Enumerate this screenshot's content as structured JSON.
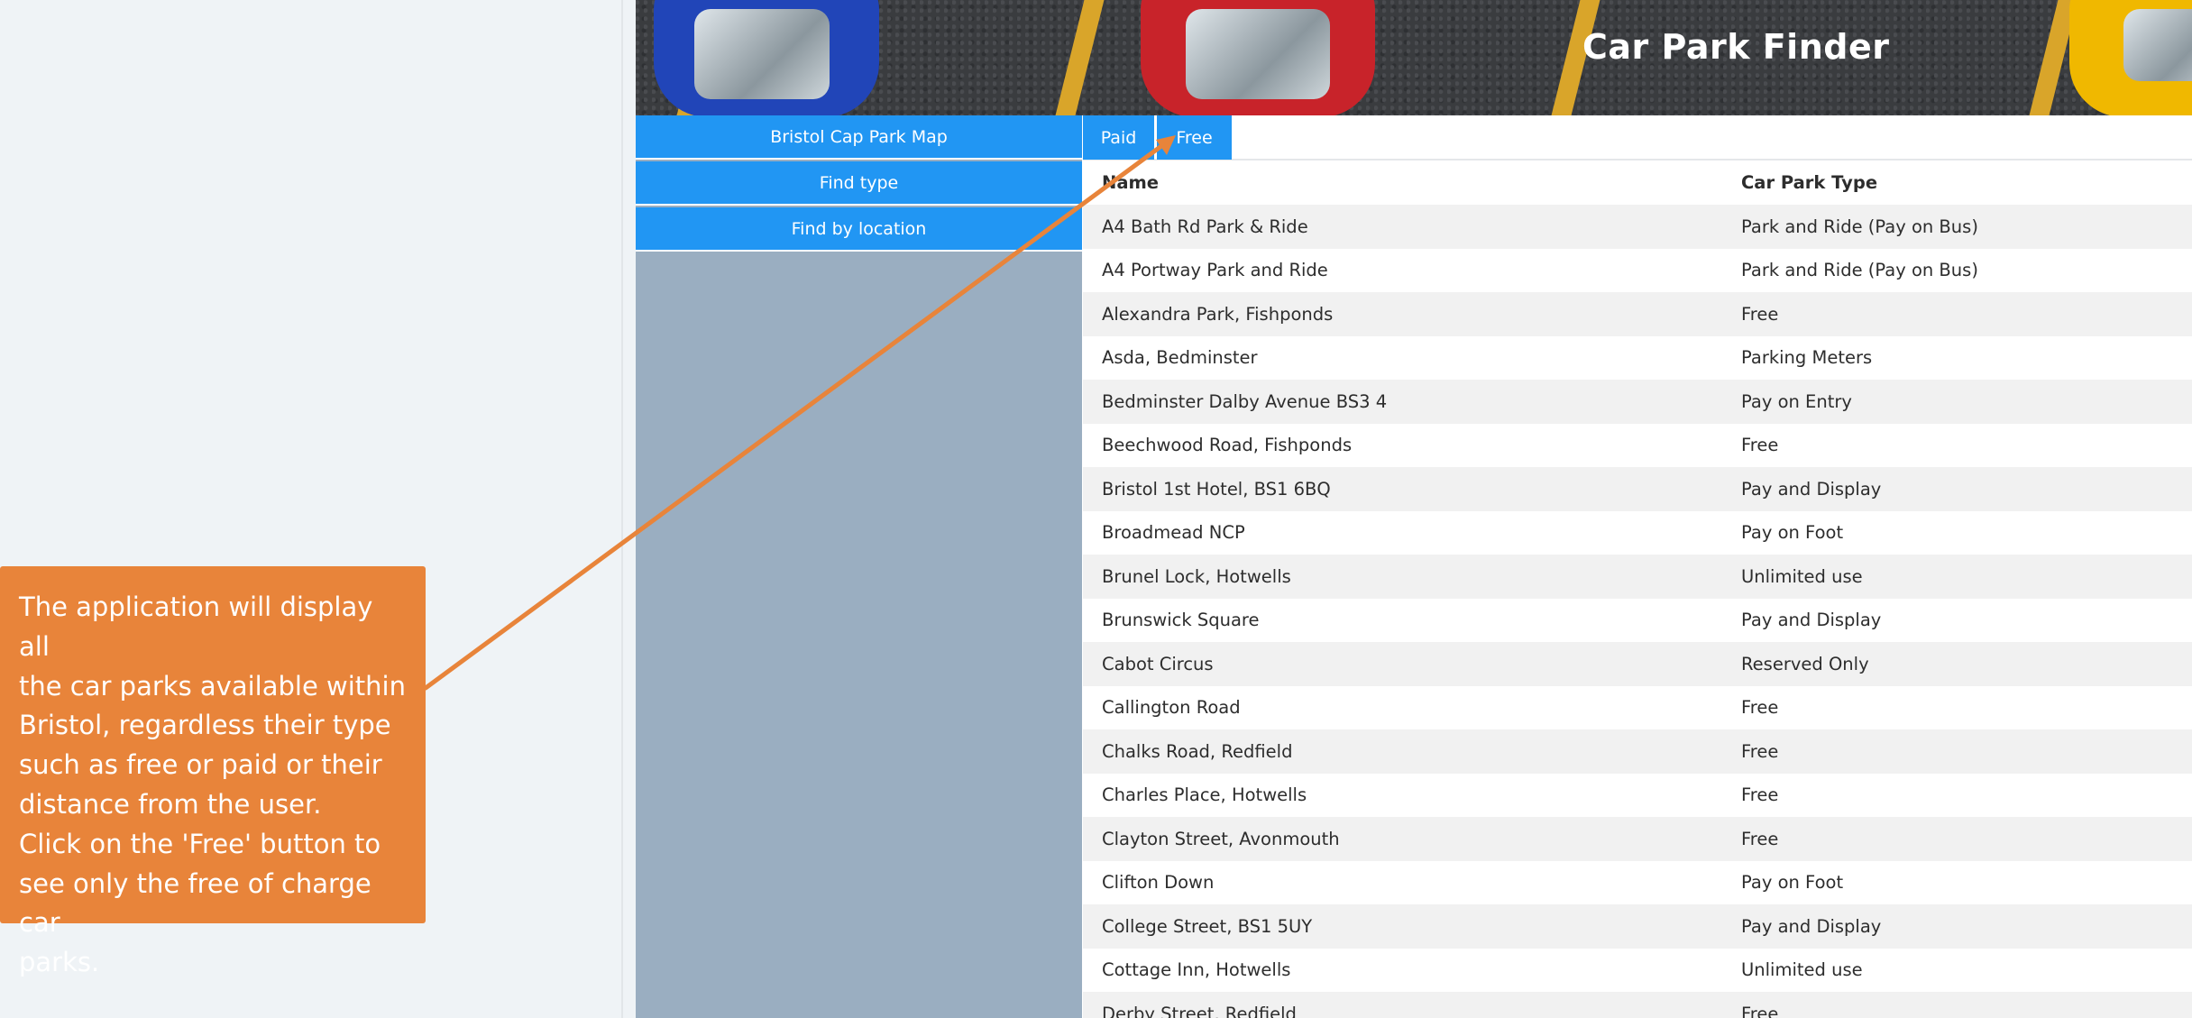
{
  "banner": {
    "title": "Car Park Finder"
  },
  "sidebar": {
    "items": [
      {
        "label": "Bristol Cap Park Map"
      },
      {
        "label": "Find type"
      },
      {
        "label": "Find by location"
      }
    ]
  },
  "tabs": [
    {
      "label": "Paid"
    },
    {
      "label": "Free"
    }
  ],
  "table": {
    "columns": [
      "Name",
      "Car Park Type"
    ],
    "rows": [
      [
        "A4 Bath Rd Park & Ride",
        "Park and Ride (Pay on Bus)"
      ],
      [
        "A4 Portway Park and Ride",
        "Park and Ride (Pay on Bus)"
      ],
      [
        "Alexandra Park, Fishponds",
        "Free"
      ],
      [
        "Asda, Bedminster",
        "Parking Meters"
      ],
      [
        "Bedminster Dalby Avenue BS3 4",
        "Pay on Entry"
      ],
      [
        "Beechwood Road, Fishponds",
        "Free"
      ],
      [
        "Bristol 1st Hotel, BS1 6BQ",
        "Pay and Display"
      ],
      [
        "Broadmead NCP",
        "Pay on Foot"
      ],
      [
        "Brunel Lock, Hotwells",
        "Unlimited use"
      ],
      [
        "Brunswick Square",
        "Pay and Display"
      ],
      [
        "Cabot Circus",
        "Reserved Only"
      ],
      [
        "Callington Road",
        "Free"
      ],
      [
        "Chalks Road, Redfield",
        "Free"
      ],
      [
        "Charles Place, Hotwells",
        "Free"
      ],
      [
        "Clayton Street, Avonmouth",
        "Free"
      ],
      [
        "Clifton Down",
        "Pay on Foot"
      ],
      [
        "College Street, BS1 5UY",
        "Pay and Display"
      ],
      [
        "Cottage Inn, Hotwells",
        "Unlimited use"
      ],
      [
        "Derby Street, Redfield",
        "Free"
      ]
    ]
  },
  "callout": {
    "lines": [
      "The application will display all",
      "the car parks available within",
      "Bristol, regardless their type",
      "such as free or paid or their",
      "distance from the user.",
      "Click on the 'Free' button to",
      "see only the free of charge car",
      "parks."
    ]
  },
  "colors": {
    "accent": "#2196f3",
    "callout": "#e8843a",
    "sidebar_bg": "#9aaec1",
    "page_bg": "#eff3f6"
  }
}
